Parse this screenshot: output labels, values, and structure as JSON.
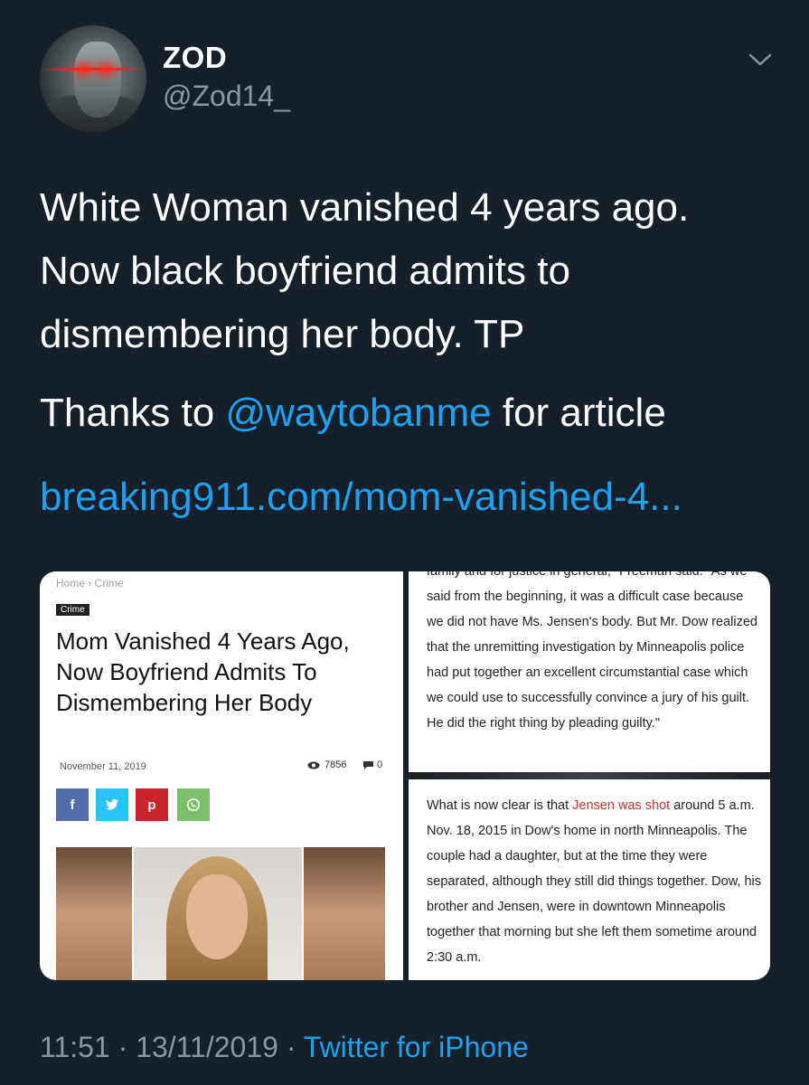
{
  "author": {
    "display_name": "ZOD",
    "handle": "@Zod14_"
  },
  "tweet": {
    "lines": [
      "White Woman vanished 4 years ago.",
      "Now black boyfriend admits to",
      "dismembering her body. TP"
    ],
    "thanks_prefix": "Thanks to",
    "mention": "@waytobanme",
    "thanks_suffix": "for article",
    "link": "breaking911.com/mom-vanished-4..."
  },
  "media": {
    "left": {
      "breadcrumb": "Home  ›  Crime",
      "category": "Crime",
      "headline": "Mom Vanished 4 Years Ago, Now Boyfriend Admits To Dismembering Her Body",
      "date": "November 11, 2019",
      "views": "7856",
      "comments": "0",
      "share_labels": [
        "f",
        "t",
        "p",
        "w"
      ]
    },
    "top_right": {
      "text": "family and for justice in general,\" Freeman said. \"As we said from the beginning, it was a difficult case because we did not have Ms. Jensen's body. But Mr. Dow realized that the unremitting investigation by Minneapolis police had put together an excellent circumstantial case which we could use to successfully convince a jury of his guilt. He did the right thing by pleading guilty.\""
    },
    "bottom_right": {
      "text_before": "What is now clear is that ",
      "highlight": "Jensen was shot",
      "text_after": " around 5 a.m. Nov. 18, 2015 in Dow's home in north Minneapolis. The couple had a daughter, but at the time they were separated, although they still did things together. Dow, his brother and Jensen, were in downtown Minneapolis together that morning but she left them sometime around 2:30 a.m."
    }
  },
  "footer": {
    "time": "11:51 · 13/11/2019 · ",
    "source": "Twitter for iPhone"
  },
  "colors": {
    "background": "#15202b",
    "link": "#1da1f2",
    "muted": "#8899a6"
  }
}
